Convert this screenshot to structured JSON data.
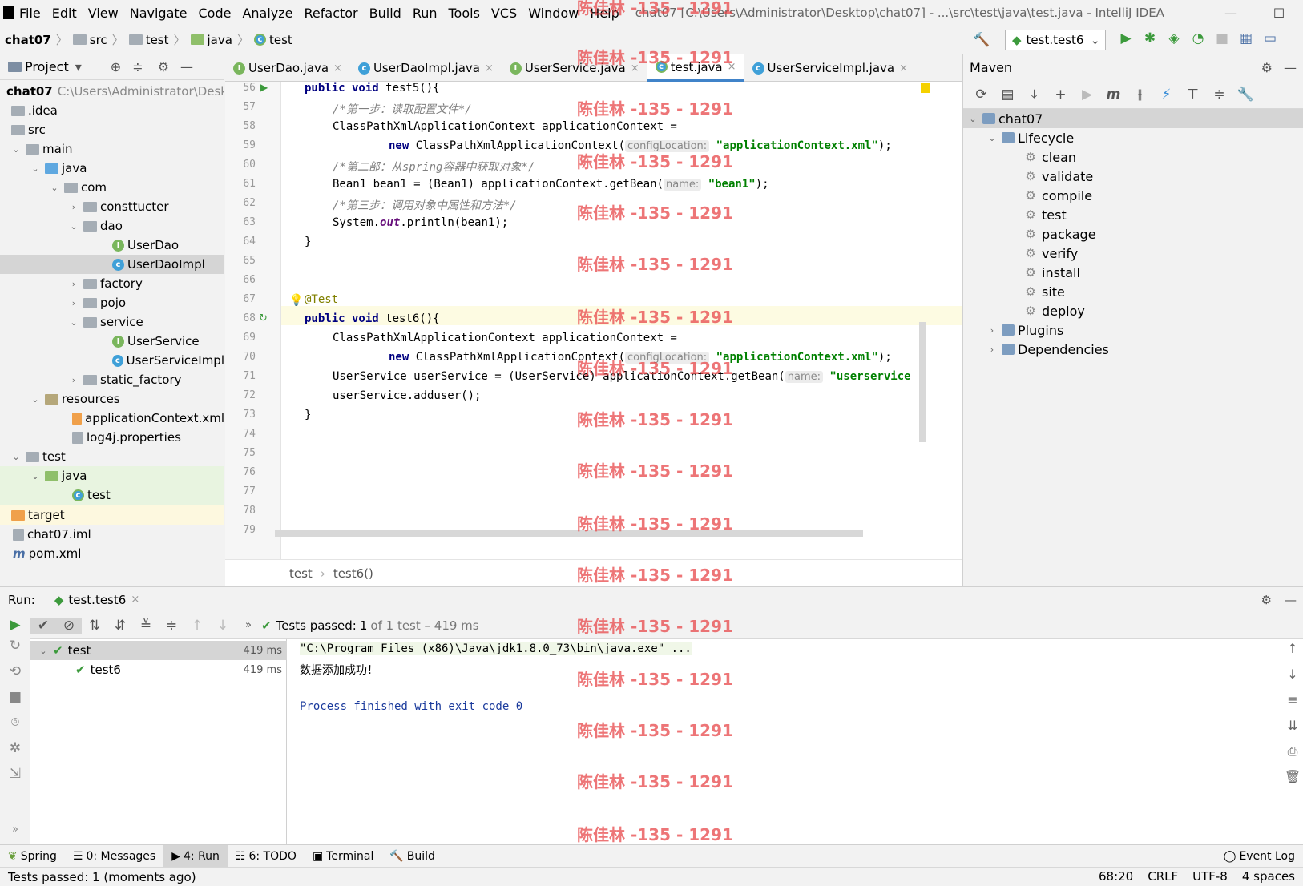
{
  "menu": {
    "items": [
      "File",
      "Edit",
      "View",
      "Navigate",
      "Code",
      "Analyze",
      "Refactor",
      "Build",
      "Run",
      "Tools",
      "VCS",
      "Window",
      "Help"
    ],
    "window_title": "chat07 [C:\\Users\\Administrator\\Desktop\\chat07] - ...\\src\\test\\java\\test.java - IntelliJ IDEA"
  },
  "navbar": {
    "crumbs": [
      "chat07",
      "src",
      "test",
      "java",
      "test"
    ],
    "run_config": "test.test6"
  },
  "project": {
    "title": "Project",
    "root_name": "chat07",
    "root_path": "C:\\Users\\Administrator\\Deskt",
    "tree": [
      {
        "label": "chat07",
        "level": 0
      },
      {
        "label": ".idea",
        "level": 0
      },
      {
        "label": "src",
        "level": 0
      },
      {
        "label": "main",
        "level": 1
      },
      {
        "label": "java",
        "level": 2
      },
      {
        "label": "com",
        "level": 3
      },
      {
        "label": "consttucter",
        "level": 4
      },
      {
        "label": "dao",
        "level": 4
      },
      {
        "label": "UserDao",
        "level": 5
      },
      {
        "label": "UserDaoImpl",
        "level": 5
      },
      {
        "label": "factory",
        "level": 4
      },
      {
        "label": "pojo",
        "level": 4
      },
      {
        "label": "service",
        "level": 4
      },
      {
        "label": "UserService",
        "level": 5
      },
      {
        "label": "UserServiceImpl",
        "level": 5
      },
      {
        "label": "static_factory",
        "level": 4
      },
      {
        "label": "resources",
        "level": 2
      },
      {
        "label": "applicationContext.xml",
        "level": 3
      },
      {
        "label": "log4j.properties",
        "level": 3
      },
      {
        "label": "test",
        "level": 1
      },
      {
        "label": "java",
        "level": 2
      },
      {
        "label": "test",
        "level": 3
      },
      {
        "label": "target",
        "level": 0
      },
      {
        "label": "chat07.iml",
        "level": 0
      },
      {
        "label": "pom.xml",
        "level": 0
      }
    ]
  },
  "tabs": [
    "UserDao.java",
    "UserDaoImpl.java",
    "UserService.java",
    "test.java",
    "UserServiceImpl.java"
  ],
  "active_tab": "test.java",
  "editor": {
    "line_numbers": [
      "56",
      "57",
      "58",
      "59",
      "60",
      "61",
      "62",
      "63",
      "64",
      "65",
      "66",
      "67",
      "68",
      "69",
      "70",
      "71",
      "72",
      "73",
      "74",
      "75",
      "76",
      "77",
      "78",
      "79"
    ],
    "hint_config": "configLocation:",
    "hint_name": "name:",
    "str_xml": "\"applicationContext.xml\"",
    "str_bean1": "\"bean1\"",
    "str_userservice": "\"userservice",
    "line56_a": "public void",
    "line56_b": " test5(){",
    "line57": "/*第一步：读取配置文件*/",
    "line58": "ClassPathXmlApplicationContext applicationContext =",
    "line59_kw": "new",
    "line59_b": " ClassPathXmlApplicationContext(",
    "line59_end": ");",
    "line60": "/*第二部：从spring容器中获取对象*/",
    "line61_a": "Bean1 bean1 = (Bean1) applicationContext.getBean(",
    "line61_end": ");",
    "line62": "/*第三步：调用对象中属性和方法*/",
    "line63_a": "System.",
    "line63_it": "out",
    "line63_b": ".println(bean1);",
    "close_brace": "}",
    "line67": "@Test",
    "line68_a": "public void",
    "line68_b": " test6(){",
    "line71_a": "UserService userService = (UserService) applicationContext.getBean(",
    "line72": "userService.adduser();",
    "breadcrumb": [
      "test",
      "test6()"
    ]
  },
  "maven": {
    "title": "Maven",
    "project": "chat07",
    "lifecycle_label": "Lifecycle",
    "goals": [
      "clean",
      "validate",
      "compile",
      "test",
      "package",
      "verify",
      "install",
      "site",
      "deploy"
    ],
    "plugins_label": "Plugins",
    "dependencies_label": "Dependencies"
  },
  "run": {
    "label": "Run:",
    "tab": "test.test6",
    "status_prefix": "Tests passed:",
    "status_count": "1",
    "status_suffix": "of 1 test – 419 ms",
    "tree": [
      {
        "name": "test",
        "time": "419 ms"
      },
      {
        "name": "test6",
        "time": "419 ms"
      }
    ],
    "console": [
      "\"C:\\Program Files (x86)\\Java\\jdk1.8.0_73\\bin\\java.exe\" ...",
      "数据添加成功！",
      "",
      "Process finished with exit code 0"
    ]
  },
  "toolwindows": [
    "Spring",
    "0: Messages",
    "4: Run",
    "6: TODO",
    "Terminal",
    "Build",
    "Event Log"
  ],
  "status": {
    "left": "Tests passed: 1 (moments ago)",
    "position": "68:20",
    "line_sep": "CRLF",
    "encoding": "UTF-8",
    "indent": "4 spaces"
  },
  "watermark": "陈佳林 -135 - 1291",
  "colors": {
    "accent": "#4083c9",
    "pass_green": "#3c9a3c",
    "watermark": "#e8484a"
  }
}
